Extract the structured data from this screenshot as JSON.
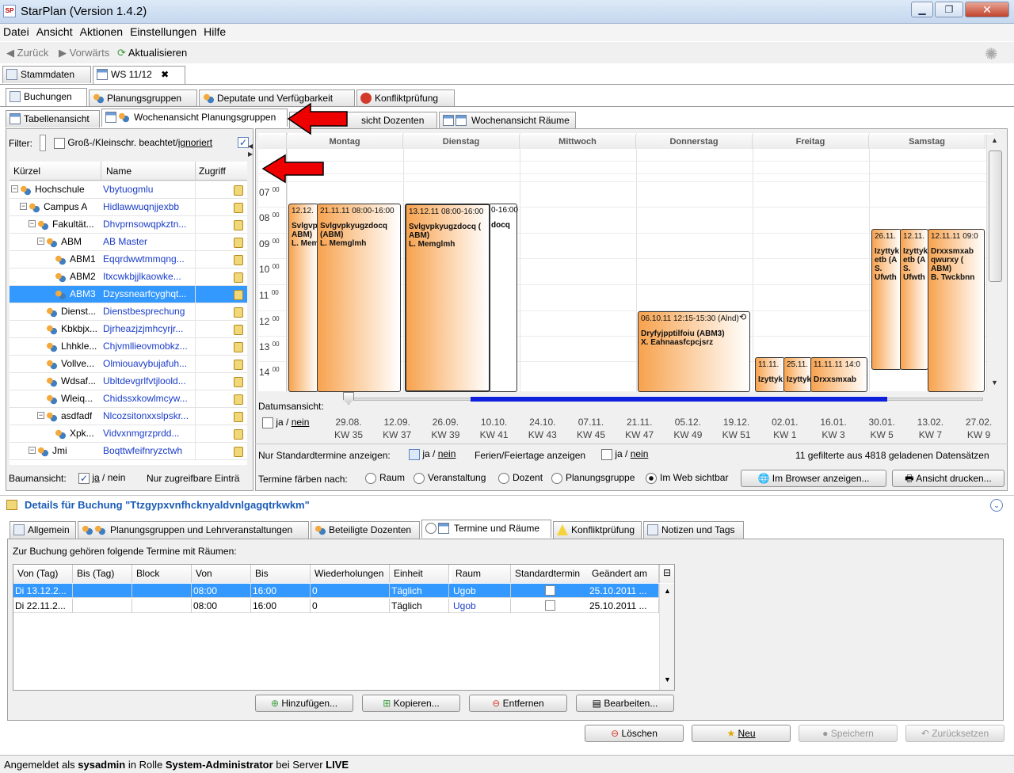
{
  "window": {
    "title": "StarPlan (Version 1.4.2)",
    "logo": "SP"
  },
  "menu": [
    "Datei",
    "Ansicht",
    "Aktionen",
    "Einstellungen",
    "Hilfe"
  ],
  "toolbar": {
    "back": "Zurück",
    "forward": "Vorwärts",
    "refresh": "Aktualisieren"
  },
  "top_tabs": [
    {
      "label": "Stammdaten"
    },
    {
      "label": "WS 11/12",
      "close": "✖"
    }
  ],
  "main_tabs": [
    "Buchungen",
    "Planungsgruppen",
    "Deputate und Verfügbarkeit",
    "Konfliktprüfung"
  ],
  "sub_tabs": [
    "Tabellenansicht",
    "Wochenansicht Planungsgruppen",
    "Wochenansicht Dozenten",
    "Wochenansicht Räume"
  ],
  "sub_tab_partial_label": "sicht Dozenten",
  "filter": {
    "label": "Filter:",
    "case_label": "Groß-/Kleinschr. beachtet/",
    "case_ignored": "ignoriert"
  },
  "tree": {
    "headers": {
      "code": "Kürzel",
      "name": "Name",
      "access": "Zugriff"
    },
    "rows": [
      {
        "code": "Hochschule",
        "name": "Vbytuogmlu",
        "level": 0,
        "toggle": "−"
      },
      {
        "code": "Campus A",
        "name": "Hidlawwuqnjjexbb",
        "level": 1,
        "toggle": "−"
      },
      {
        "code": "Fakultät...",
        "name": "Dhvprnsowqpkztn...",
        "level": 2,
        "toggle": "−"
      },
      {
        "code": "ABM",
        "name": "AB Master",
        "level": 3,
        "toggle": "−"
      },
      {
        "code": "ABM1",
        "name": "Eqqrdwwtmmqng...",
        "level": 4,
        "toggle": ""
      },
      {
        "code": "ABM2",
        "name": "Itxcwkbjjlkaowke...",
        "level": 4,
        "toggle": ""
      },
      {
        "code": "ABM3",
        "name": "Dzyssnearfcyghqt...",
        "level": 4,
        "toggle": "",
        "selected": true
      },
      {
        "code": "Dienst...",
        "name": "Dienstbesprechung",
        "level": 3,
        "toggle": ""
      },
      {
        "code": "Kbkbjx...",
        "name": "Djrheazjzjmhcyrjr...",
        "level": 3,
        "toggle": ""
      },
      {
        "code": "Lhhkle...",
        "name": "Chjvmllieovmobkz...",
        "level": 3,
        "toggle": ""
      },
      {
        "code": "Vollve...",
        "name": "Olmiouavybujafuh...",
        "level": 3,
        "toggle": ""
      },
      {
        "code": "Wdsaf...",
        "name": "Ubltdevgrlfvtjloold...",
        "level": 3,
        "toggle": ""
      },
      {
        "code": "Wleiq...",
        "name": "Chidssxkowlmcyw...",
        "level": 3,
        "toggle": ""
      },
      {
        "code": "asdfadf",
        "name": "Nlcozsitonxxslpskr...",
        "level": 3,
        "toggle": "−"
      },
      {
        "code": "Xpk...",
        "name": "Vidvxnmgrzprdd...",
        "level": 4,
        "toggle": ""
      },
      {
        "code": "Jmi",
        "name": "Boqttwfeifnryzctwh",
        "level": 2,
        "toggle": "−"
      }
    ],
    "tree_view_label": "Baumansicht:",
    "tree_view_yes": "ja",
    "tree_view_no": "nein",
    "only_accessible": "Nur zugreifbare Einträ"
  },
  "calendar": {
    "days": [
      "Montag",
      "Dienstag",
      "Mittwoch",
      "Donnerstag",
      "Freitag",
      "Samstag"
    ],
    "hours": [
      "07",
      "08",
      "09",
      "10",
      "11",
      "12",
      "13",
      "14"
    ],
    "minutes": "00",
    "events": [
      {
        "header": "12.12.",
        "l1": "Svlgvp",
        "l2": "ABM)",
        "l3": "L. Mem"
      },
      {
        "header": "21.11.11 08:00-16:00",
        "l1": "Svlgvpkyugzdocq",
        "l2": "(ABM)",
        "l3": "L. Memglmh"
      },
      {
        "header": "13.12.11 08:00-16:00",
        "tail": "0-16:00",
        "l1": "Svlgvpkyugzdocq (",
        "l1b": "docq",
        "l2": "ABM)",
        "l3": "L. Memglmh"
      },
      {
        "header": "06.10.11 12:15-15:30 (Alnd)",
        "l1": "Dryfyjpptilfoiu (ABM3)",
        "l2": "X. Eahnaasfcpcjsrz"
      },
      {
        "header": "11.11.",
        "l1": "Izyttyk"
      },
      {
        "header": "25.11.",
        "l1": "Izyttyk"
      },
      {
        "header": "11.11.11 14:0",
        "l1": "Drxxsmxab"
      },
      {
        "header": "26.11.",
        "l1": "Izyttyk",
        "l2": "etb (A",
        "l3": "S.",
        "l4": "Ufwth"
      },
      {
        "header": "12.11.",
        "l1": "Izyttyk",
        "l2": "etb (A",
        "l3": "S.",
        "l4": "Ufwth"
      },
      {
        "header": "12.11.11 09:0",
        "l1": "Drxxsmxab",
        "l2": "qwurxy (",
        "l3": "ABM)",
        "l4": "B. Twckbnn"
      }
    ]
  },
  "date_view": {
    "label": "Datumsansicht:",
    "yes": "ja",
    "no": "nein",
    "weeks": [
      {
        "d": "29.08.",
        "kw": "KW 35"
      },
      {
        "d": "12.09.",
        "kw": "KW 37"
      },
      {
        "d": "26.09.",
        "kw": "KW 39"
      },
      {
        "d": "10.10.",
        "kw": "KW 41"
      },
      {
        "d": "24.10.",
        "kw": "KW 43"
      },
      {
        "d": "07.11.",
        "kw": "KW 45"
      },
      {
        "d": "21.11.",
        "kw": "KW 47"
      },
      {
        "d": "05.12.",
        "kw": "KW 49"
      },
      {
        "d": "19.12.",
        "kw": "KW 51"
      },
      {
        "d": "02.01.",
        "kw": "KW 1"
      },
      {
        "d": "16.01.",
        "kw": "KW 3"
      },
      {
        "d": "30.01.",
        "kw": "KW 5"
      },
      {
        "d": "13.02.",
        "kw": "KW 7"
      },
      {
        "d": "27.02.",
        "kw": "KW 9"
      }
    ]
  },
  "options": {
    "standard_only": "Nur Standardtermine anzeigen:",
    "holidays": "Ferien/Feiertage anzeigen",
    "yes": "ja",
    "no": "nein",
    "count": "11 gefilterte aus 4818 geladenen Datensätzen",
    "color_by": "Termine färben nach:",
    "radios": [
      "Raum",
      "Veranstaltung",
      "Dozent",
      "Planungsgruppe",
      "Im Web sichtbar"
    ],
    "browser_btn": "Im Browser anzeigen...",
    "print_btn": "Ansicht drucken..."
  },
  "details": {
    "title": "Details für Buchung \"Ttzgypxvnfhcknyaldvnlgagqtrkwkm\"",
    "tabs": [
      "Allgemein",
      "Planungsgruppen und Lehrveranstaltungen",
      "Beteiligte Dozenten",
      "Termine und Räume",
      "Konfliktprüfung",
      "Notizen und Tags"
    ],
    "intro": "Zur Buchung gehören folgende Termine mit Räumen:",
    "columns": [
      "Von (Tag)",
      "Bis (Tag)",
      "Block",
      "Von",
      "Bis",
      "Wiederholungen",
      "Einheit",
      "Raum",
      "Standardtermin",
      "Geändert am"
    ],
    "rows": [
      {
        "from_day": "Di 13.12.2...",
        "to_day": "",
        "block": "",
        "from": "08:00",
        "to": "16:00",
        "rep": "0",
        "unit": "Täglich",
        "room": "Ugob",
        "changed": "25.10.2011 ...",
        "selected": true
      },
      {
        "from_day": "Di 22.11.2...",
        "to_day": "",
        "block": "",
        "from": "08:00",
        "to": "16:00",
        "rep": "0",
        "unit": "Täglich",
        "room": "Ugob",
        "changed": "25.10.2011 ...",
        "selected": false
      }
    ],
    "buttons": [
      "Hinzufügen...",
      "Kopieren...",
      "Entfernen",
      "Bearbeiten..."
    ]
  },
  "footer_buttons": [
    "Löschen",
    "Neu",
    "Speichern",
    "Zurücksetzen"
  ],
  "status": {
    "prefix": "Angemeldet als",
    "user": "sysadmin",
    "mid": "in Rolle",
    "role": "System-Administrator",
    "mid2": "bei Server",
    "server": "LIVE"
  }
}
